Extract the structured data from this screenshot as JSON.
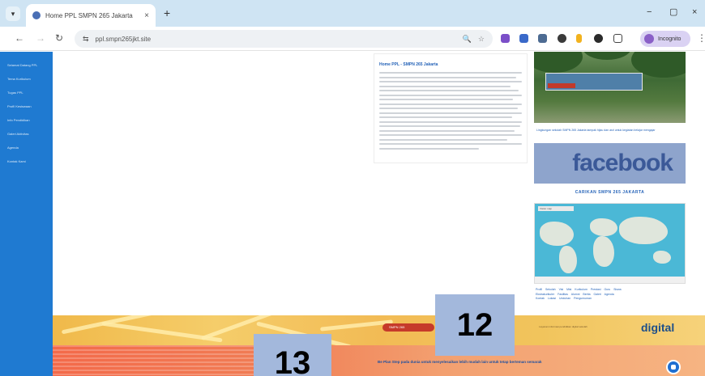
{
  "browser": {
    "tab_title": "Home PPL SMPN 265 Jakarta",
    "tab_close": "×",
    "new_tab": "+",
    "url": "ppl.smpn265jkt.site",
    "back": "←",
    "forward": "→",
    "reload": "↻",
    "site_info": "⇆",
    "zoom_icon": "🔍",
    "star_icon": "☆",
    "profile_label": "Incognito",
    "kebab": "⋮",
    "minimize": "−",
    "maximize": "▢",
    "close": "×",
    "menu_glyph": "▾"
  },
  "sidebar": {
    "items": [
      {
        "label": "Selamat Datang PPL"
      },
      {
        "label": "Tema Kurikulum"
      },
      {
        "label": "Tugas PPL"
      },
      {
        "label": "Profil Kesiswaan"
      },
      {
        "label": "Info Pendidikan"
      },
      {
        "label": "Galeri Aktivitas"
      },
      {
        "label": "Agenda"
      },
      {
        "label": "Kontak Kami"
      }
    ]
  },
  "post": {
    "title": "Home PPL - SMPN 265 Jakarta"
  },
  "right_column": {
    "photo_caption": "Lingkungan sekolah SMPN 265 Jakarta tampak hijau dan asri untuk kegiatan belajar mengajar",
    "facebook_text": "facebook",
    "facebook_caption": "CARIKAN SMPN 265 JAKARTA",
    "map_tag": "Visitor map",
    "links_rows": [
      "Profil Sekolah Visi Misi Kurikulum Prestasi Guru Siswa",
      "Ekstrakurikuler Fasilitas Alumni Berita Galeri Agenda",
      "Kontak Lokasi Unduhan Pengumuman"
    ]
  },
  "footer": {
    "badge_text": "SMPN 265",
    "note": "Layanan informasi pendidikan digital sekolah",
    "digital_text": "digital",
    "ticker_text": "Be Plan Step pada dunia untuk menyelesaikan lebih mudah lain untuk tetap berteman semarak"
  },
  "markers": {
    "marker_12": "12",
    "marker_13": "13"
  },
  "colors": {
    "sidebar": "#1f7ad1",
    "tabbar": "#cfe4f3",
    "accent_link": "#2563b8",
    "footer_gold": "#f0b94a",
    "ticker_orange": "#f36a4a",
    "marker": "#a3b8dc"
  }
}
